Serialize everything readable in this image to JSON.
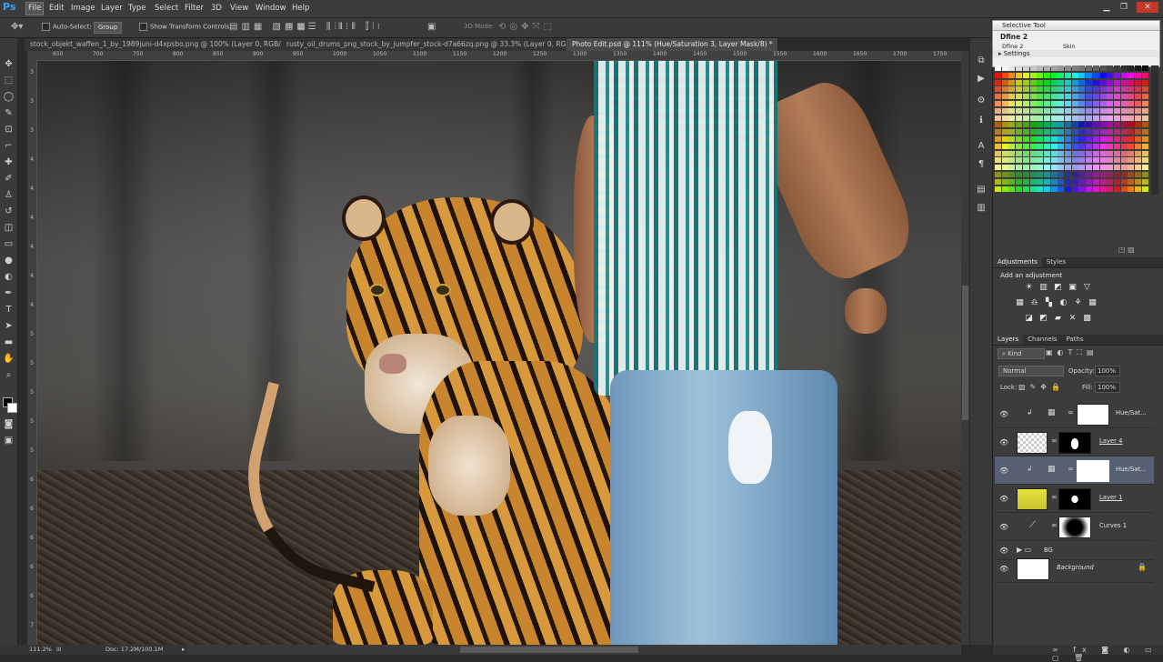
{
  "app": {
    "logo": "Ps",
    "min": "▁",
    "restore": "❐",
    "close": "✕"
  },
  "menu": [
    "File",
    "Edit",
    "Image",
    "Layer",
    "Type",
    "Select",
    "Filter",
    "3D",
    "View",
    "Window",
    "Help"
  ],
  "options": {
    "auto_select_label": "Auto-Select:",
    "group_value": "Group",
    "show_transform_label": "Show Transform Controls",
    "mode_3d_label": "3D Mode:"
  },
  "tabs": [
    {
      "label": "stock_objekt_waffen_1_by_1989juni-d4xpsbo.png @ 100% (Layer 0, RGB/8#)",
      "close": "✕"
    },
    {
      "label": "rusty_oil_drums_png_stock_by_jumpfer_stock-d7a66zq.png @ 33.3% (Layer 0, RGB/8)",
      "close": "✕"
    },
    {
      "label": "Photo Edit.psd @ 111% (Hue/Saturation 3, Layer Mask/8) *",
      "close": "✕"
    }
  ],
  "ruler": {
    "h": [
      "650",
      "700",
      "750",
      "800",
      "850",
      "900",
      "950",
      "1000",
      "1050",
      "1100",
      "1150",
      "1200",
      "1250",
      "1300",
      "1350",
      "1400",
      "1450",
      "1500",
      "1550",
      "1600",
      "1650",
      "1700",
      "1750"
    ],
    "v": [
      "3",
      "3",
      "3",
      "4",
      "4",
      "4",
      "4",
      "4",
      "4",
      "5",
      "5",
      "5",
      "5",
      "5",
      "6",
      "6",
      "6",
      "6",
      "6",
      "7"
    ]
  },
  "status": {
    "zoom": "111.2%",
    "doc": "Doc: 17.2M/100.1M"
  },
  "selective_tool": {
    "title": "Selective Tool",
    "name": "Dfine 2",
    "item1": "Dfine 2",
    "item2": "Skin",
    "settings": "Settings"
  },
  "adjustments": {
    "tabs": [
      "Adjustments",
      "Styles"
    ],
    "heading": "Add an adjustment",
    "row1": [
      "☀",
      "▥",
      "◩",
      "▣",
      "▽"
    ],
    "row2": [
      "▦",
      "♎",
      "▚",
      "◐",
      "⚘",
      "▦"
    ],
    "row3": [
      "◪",
      "◩",
      "▰",
      "✕",
      "▩"
    ]
  },
  "layers_panel": {
    "tabs": [
      "Layers",
      "Channels",
      "Paths"
    ],
    "kind": "Kind",
    "blend": "Normal",
    "opacity_label": "Opacity:",
    "opacity": "100%",
    "lock_label": "Lock:",
    "fill_label": "Fill:",
    "fill": "100%"
  },
  "layers": [
    {
      "name": "Hue/Sat...",
      "style": "normal",
      "selected": false
    },
    {
      "name": "Layer 4",
      "style": "ul",
      "selected": false
    },
    {
      "name": "Hue/Sat...",
      "style": "normal",
      "selected": true
    },
    {
      "name": "Layer 1",
      "style": "ul",
      "selected": false
    },
    {
      "name": "Curves 1",
      "style": "normal",
      "selected": false
    },
    {
      "name": "BG",
      "style": "normal",
      "selected": false
    },
    {
      "name": "Background",
      "style": "it",
      "selected": false
    }
  ],
  "icons": {
    "eye": "👁",
    "lock": "🔒",
    "folder": "▶ ▭",
    "chain": "∞"
  }
}
